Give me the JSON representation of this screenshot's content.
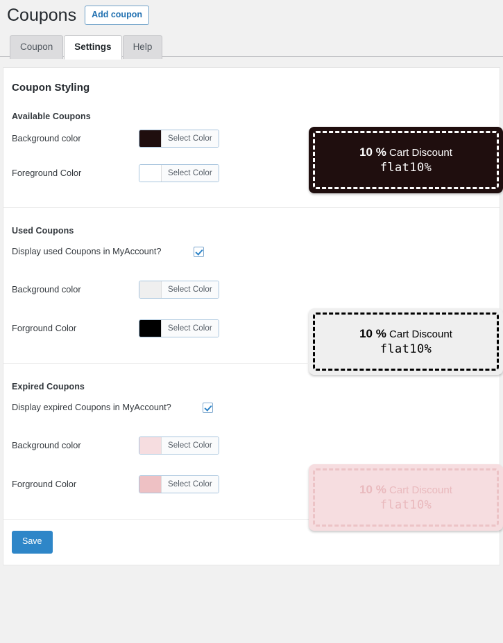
{
  "header": {
    "title": "Coupons",
    "add_button": "Add coupon"
  },
  "tabs": [
    {
      "label": "Coupon",
      "active": false
    },
    {
      "label": "Settings",
      "active": true
    },
    {
      "label": "Help",
      "active": false
    }
  ],
  "panel": {
    "title": "Coupon Styling"
  },
  "sections": {
    "available": {
      "heading": "Available Coupons",
      "background_label": "Background color",
      "background_button": "Select Color",
      "background_color": "#1f0e0e",
      "foreground_label": "Foreground Color",
      "foreground_button": "Select Color",
      "foreground_color": "#ffffff",
      "preview": {
        "percent": "10 %",
        "discount": "Cart Discount",
        "code": "flat10%"
      }
    },
    "used": {
      "heading": "Used Coupons",
      "display_label": "Display used Coupons in MyAccount?",
      "display_checked": true,
      "background_label": "Background color",
      "background_button": "Select Color",
      "background_color": "#efefef",
      "foreground_label": "Forground Color",
      "foreground_button": "Select Color",
      "foreground_color": "#000000",
      "preview": {
        "percent": "10 %",
        "discount": "Cart Discount",
        "code": "flat10%"
      }
    },
    "expired": {
      "heading": "Expired Coupons",
      "display_label": "Display expired Coupons in MyAccount?",
      "display_checked": true,
      "background_label": "Background color",
      "background_button": "Select Color",
      "background_color": "#f6dde0",
      "foreground_label": "Forground Color",
      "foreground_button": "Select Color",
      "foreground_color": "#eec1c4",
      "preview": {
        "percent": "10 %",
        "discount": "Cart Discount",
        "code": "flat10%"
      }
    }
  },
  "footer": {
    "save_label": "Save"
  },
  "theme": {
    "accent_blue": "#2e86c8",
    "link_blue": "#2271b1",
    "page_background": "#f1f1f1"
  }
}
